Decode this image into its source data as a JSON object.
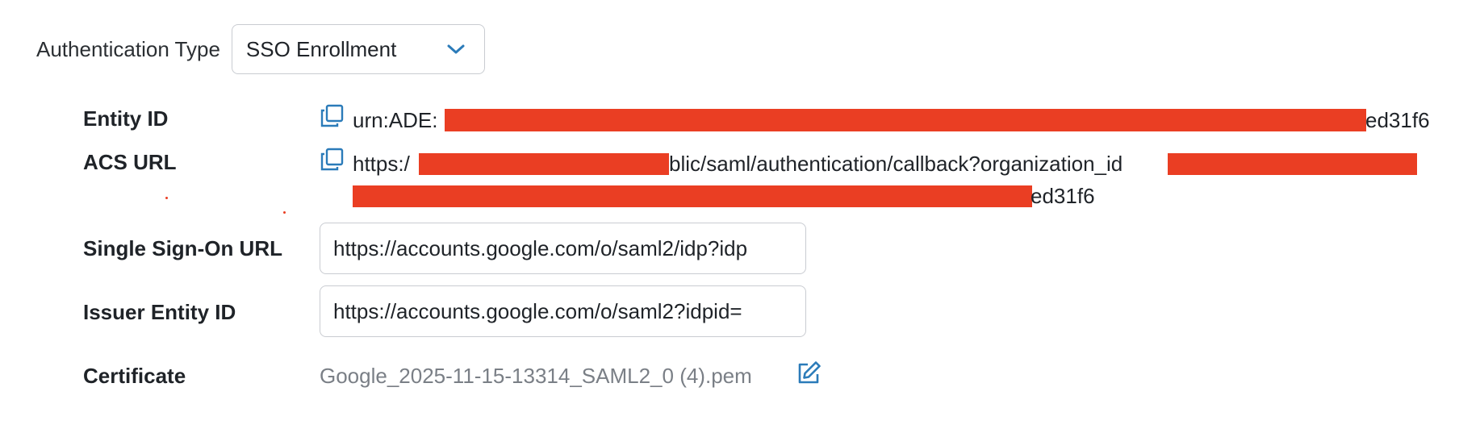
{
  "auth": {
    "label": "Authentication Type",
    "selected": "SSO Enrollment"
  },
  "entity_id": {
    "label": "Entity ID",
    "value_prefix": "urn:ADE:",
    "value_suffix": "ed31f6"
  },
  "acs_url": {
    "label": "ACS URL",
    "value_prefix": "https:/",
    "value_middle": "blic/saml/authentication/callback?organization_id",
    "value_line2_suffix": "ed31f6"
  },
  "sso_url": {
    "label": "Single Sign-On URL",
    "value": "https://accounts.google.com/o/saml2/idp?idp"
  },
  "issuer": {
    "label": "Issuer Entity ID",
    "value": "https://accounts.google.com/o/saml2?idpid="
  },
  "certificate": {
    "label": "Certificate",
    "filename": "Google_2025-11-15-13314_SAML2_0 (4).pem"
  },
  "colors": {
    "accent": "#2b7bb9",
    "redaction": "#ea3e23"
  },
  "icons": {
    "dropdown": "chevron-down-icon",
    "copy": "copy-icon",
    "edit": "edit-icon"
  }
}
